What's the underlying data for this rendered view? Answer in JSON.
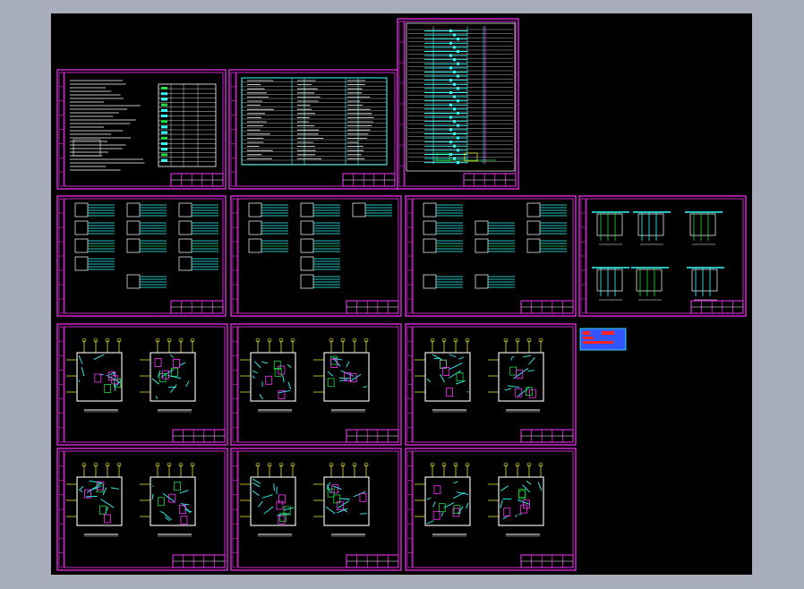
{
  "colors": {
    "background": "#a7adba",
    "viewport": "#000000",
    "frame": "#ff33ff",
    "cyan": "#33ffff",
    "white": "#ffffff",
    "green": "#22dd44",
    "yellow": "#ffff33",
    "red": "#ff2222",
    "blue": "#3355ff"
  },
  "sheets": [
    {
      "id": "design-notes",
      "type": "notes",
      "caption": ""
    },
    {
      "id": "legend-table",
      "type": "table",
      "caption": ""
    },
    {
      "id": "riser-diagram",
      "type": "riser",
      "caption": ""
    },
    {
      "id": "system-diagram-1",
      "type": "system",
      "caption": ""
    },
    {
      "id": "system-diagram-2",
      "type": "system",
      "caption": ""
    },
    {
      "id": "system-diagram-3",
      "type": "system",
      "caption": ""
    },
    {
      "id": "detail-diagram",
      "type": "detail",
      "caption": ""
    },
    {
      "id": "plan-1",
      "type": "plan",
      "caption": ""
    },
    {
      "id": "plan-2",
      "type": "plan",
      "caption": ""
    },
    {
      "id": "plan-3",
      "type": "plan",
      "caption": ""
    },
    {
      "id": "plan-4",
      "type": "plan",
      "caption": ""
    },
    {
      "id": "plan-5",
      "type": "plan",
      "caption": ""
    },
    {
      "id": "plan-6",
      "type": "plan",
      "caption": ""
    }
  ],
  "stamp": {
    "lines": [
      "",
      "",
      ""
    ]
  }
}
